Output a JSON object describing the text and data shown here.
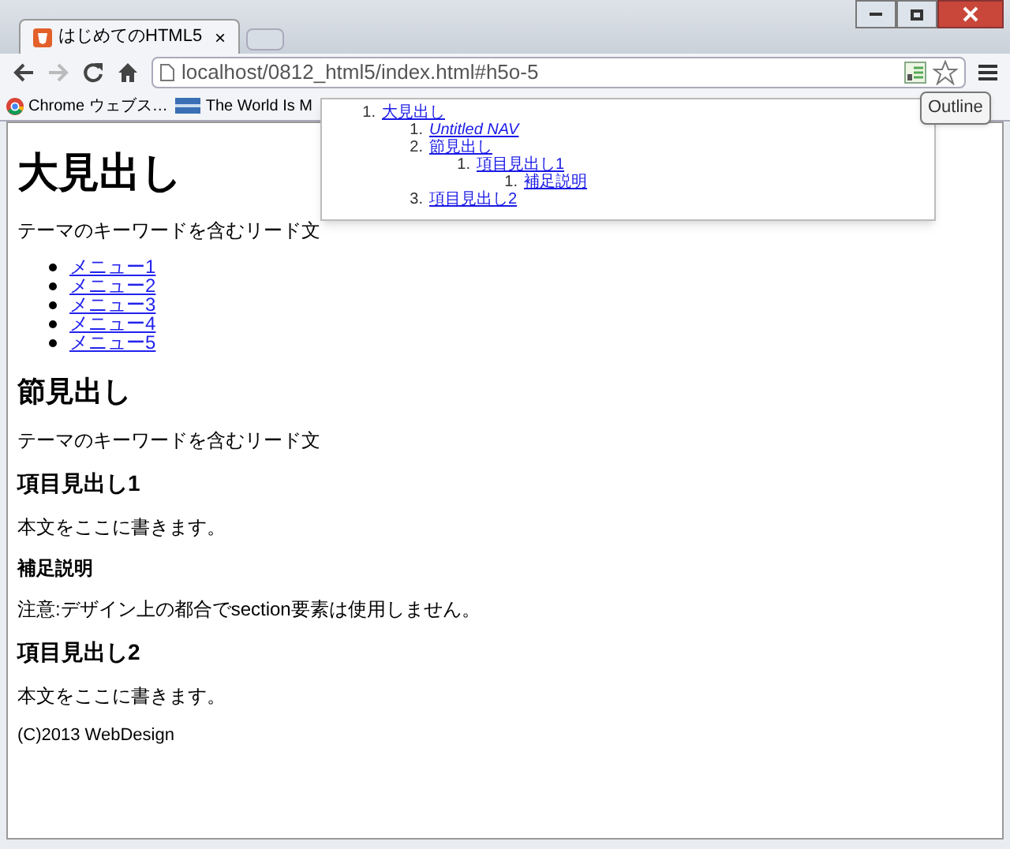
{
  "window": {
    "tab": {
      "title": "はじめてのHTML5",
      "close": "×",
      "selected": true
    }
  },
  "toolbar": {
    "url": "localhost/0812_html5/index.html#h5o-5"
  },
  "bookmarks": [
    {
      "label": "Chrome ウェブス…",
      "kind": "chrome"
    },
    {
      "label": "The World Is M",
      "kind": "flag"
    }
  ],
  "tooltip": "Outline",
  "outline": [
    {
      "number": "1.",
      "label": "大見出し",
      "italic": false,
      "children": [
        {
          "number": "1.",
          "label": "Untitled NAV",
          "italic": true
        },
        {
          "number": "2.",
          "label": "節見出し",
          "italic": false,
          "children": [
            {
              "number": "1.",
              "label": "項目見出し1",
              "italic": false,
              "children": [
                {
                  "number": "1.",
                  "label": "補足説明",
                  "italic": false
                }
              ]
            }
          ]
        },
        {
          "number": "3.",
          "label": "項目見出し2",
          "italic": false
        }
      ]
    }
  ],
  "page": [
    {
      "kind": "h1",
      "text": "大見出し"
    },
    {
      "kind": "p",
      "text": "テーマのキーワードを含むリード文"
    },
    {
      "kind": "menu",
      "items": [
        "メニュー1",
        "メニュー2",
        "メニュー3",
        "メニュー4",
        "メニュー5"
      ]
    },
    {
      "kind": "h2",
      "text": "節見出し"
    },
    {
      "kind": "p",
      "text": "テーマのキーワードを含むリード文"
    },
    {
      "kind": "h3",
      "text": "項目見出し1"
    },
    {
      "kind": "p",
      "text": "本文をここに書きます。"
    },
    {
      "kind": "h4",
      "text": "補足説明"
    },
    {
      "kind": "p",
      "text": "注意:デザイン上の都合でsection要素は使用しません。"
    },
    {
      "kind": "h3",
      "text": "項目見出し2"
    },
    {
      "kind": "p",
      "text": "本文をここに書きます。"
    },
    {
      "kind": "small",
      "text": "(C)2013 WebDesign"
    }
  ]
}
